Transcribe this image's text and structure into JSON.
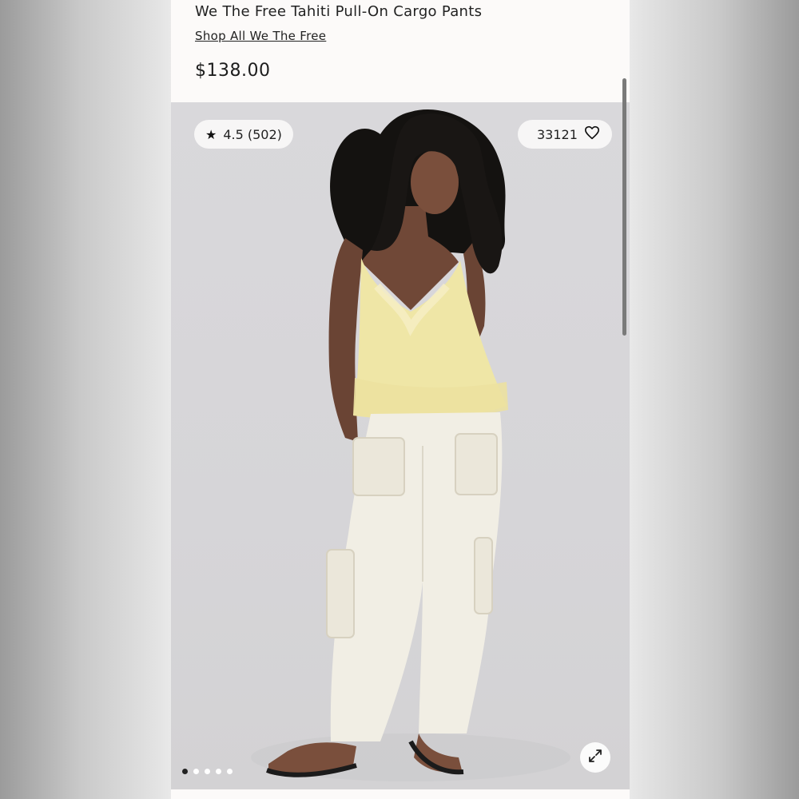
{
  "product": {
    "title": "We The Free Tahiti Pull-On Cargo Pants",
    "brand_link": "Shop All We The Free",
    "price": "$138.00"
  },
  "gallery": {
    "rating_text": "4.5 (502)",
    "favorites_count": "33121",
    "star_icon": "star-icon",
    "heart_icon": "heart-icon",
    "expand_icon": "expand-icon",
    "dots_total": 5,
    "dot_active_index": 0
  },
  "colors": {
    "top": "#efe6a6",
    "pants": "#f1eee4",
    "backdrop": "#d8d7da"
  }
}
